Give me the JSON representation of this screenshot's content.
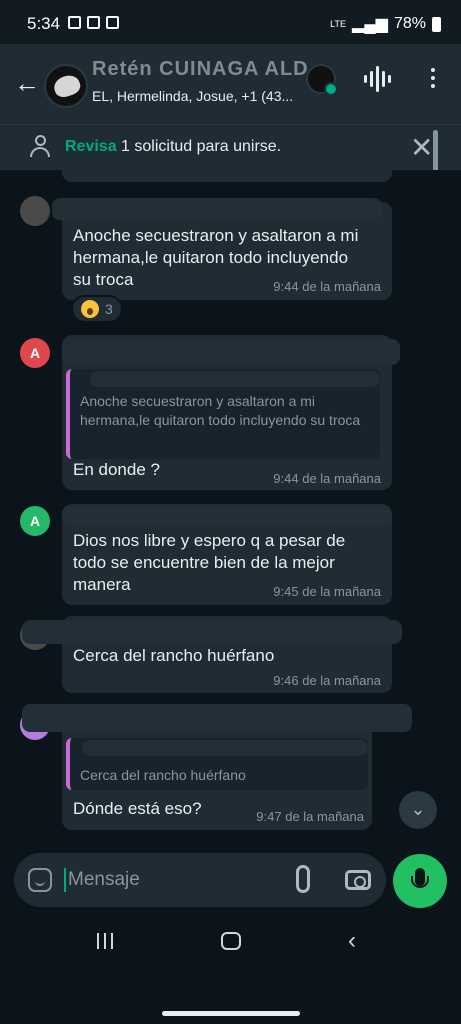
{
  "status_bar": {
    "time": "5:34",
    "battery": "78%",
    "network": "LTE"
  },
  "header": {
    "title": "Retén CUINAGA ALD...",
    "subtitle": "EL, Hermelinda, Josue, +1 (43..."
  },
  "join_banner": {
    "accent": "Revisa",
    "text": " 1 solicitud para unirse."
  },
  "messages": [
    {
      "text": "Anoche secuestraron y asaltaron a mi hermana,le quitaron todo incluyendo su troca",
      "time": "9:44 de la mañana",
      "reaction_count": "3"
    },
    {
      "avatar_initial": "A",
      "avatar_color": "#e0474c",
      "quoted": "Anoche secuestraron y asaltaron a mi hermana,le quitaron todo incluyendo su troca",
      "text": "En donde ?",
      "time": "9:44 de la mañana"
    },
    {
      "avatar_initial": "A",
      "avatar_color": "#25b76a",
      "text": "Dios nos libre y espero q a pesar de todo se encuentre bien de la mejor manera",
      "time": "9:45 de la mañana"
    },
    {
      "text": "Cerca del rancho huérfano",
      "time": "9:46 de la mañana"
    },
    {
      "quoted": "Cerca del rancho huérfano",
      "text": "Dónde está eso?",
      "time": "9:47 de la mañana"
    }
  ],
  "composer": {
    "placeholder": "Mensaje"
  },
  "colors": {
    "accent": "#00a884",
    "mic_button": "#21c063",
    "bubble": "#1f2c34",
    "background": "#0b141a"
  },
  "icons": [
    "back-arrow-icon",
    "voice-chat-icon",
    "more-options-icon",
    "person-clock-icon",
    "close-icon",
    "sticker-icon",
    "attach-icon",
    "camera-icon",
    "mic-icon",
    "chevron-down-icon"
  ]
}
